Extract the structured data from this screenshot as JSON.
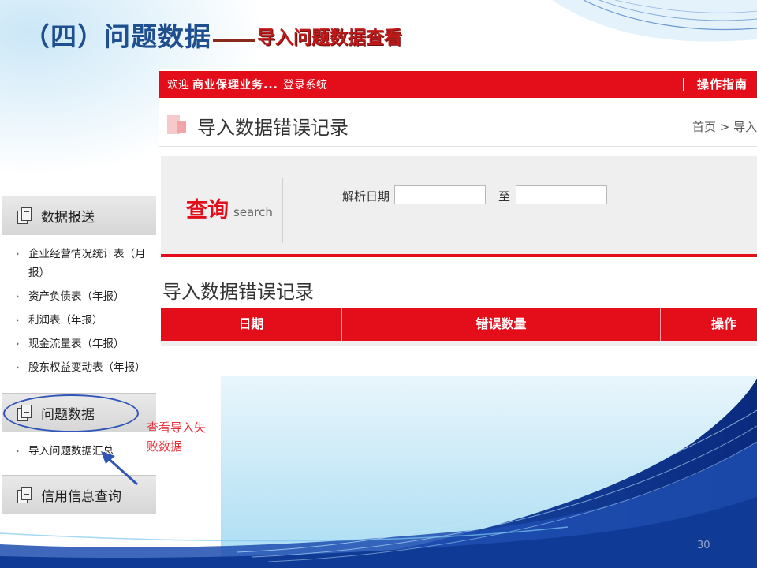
{
  "slide": {
    "title_main": "（四）问题数据",
    "title_sub": "导入问题数据查看",
    "page_number": "30"
  },
  "app": {
    "topbar": {
      "welcome": "欢迎",
      "user": "商业保理业务...",
      "login": "登录系统",
      "guide": "操作指南"
    },
    "page_heading": "导入数据错误记录",
    "breadcrumb": "首页 > 导入",
    "search": {
      "title": "查询",
      "subtitle": "search",
      "date_label": "解析日期",
      "to_label": "至",
      "date_from_value": "",
      "date_to_value": ""
    },
    "records_title": "导入数据错误记录",
    "table": {
      "columns": [
        "日期",
        "错误数量",
        "操作"
      ]
    }
  },
  "sidebar": {
    "sections": [
      {
        "label": "数据报送",
        "items": [
          "企业经营情况统计表（月报）",
          "资产负债表（年报）",
          "利润表（年报）",
          "现金流量表（年报）",
          "股东权益变动表（年报）"
        ]
      },
      {
        "label": "问题数据",
        "items": [
          "导入问题数据汇总"
        ]
      },
      {
        "label": "信用信息查询",
        "items": []
      }
    ]
  },
  "annotation": "查看导入失败数据",
  "colors": {
    "brand_red": "#e30e1a",
    "title_blue": "#1f4f8f",
    "annotation_red": "#e8323a",
    "highlight_blue": "#2f55b8"
  }
}
